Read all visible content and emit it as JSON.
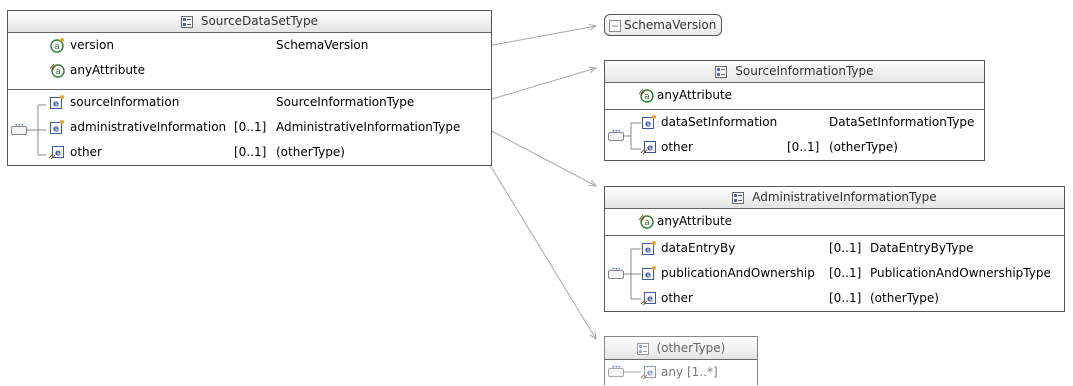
{
  "source_dataset": {
    "title": "SourceDataSetType",
    "attributes": [
      {
        "name": "version",
        "type": "SchemaVersion"
      },
      {
        "name": "anyAttribute",
        "type": ""
      }
    ],
    "elements": [
      {
        "name": "sourceInformation",
        "cardinality": "",
        "type": "SourceInformationType"
      },
      {
        "name": "administrativeInformation",
        "cardinality": "[0..1]",
        "type": "AdministrativeInformationType"
      },
      {
        "name": "other",
        "cardinality": "[0..1]",
        "type": "(otherType)"
      }
    ]
  },
  "schema_version": {
    "title": "SchemaVersion"
  },
  "source_information": {
    "title": "SourceInformationType",
    "attribute": "anyAttribute",
    "elements": [
      {
        "name": "dataSetInformation",
        "cardinality": "",
        "type": "DataSetInformationType"
      },
      {
        "name": "other",
        "cardinality": "[0..1]",
        "type": "(otherType)"
      }
    ]
  },
  "administrative_information": {
    "title": "AdministrativeInformationType",
    "attribute": "anyAttribute",
    "elements": [
      {
        "name": "dataEntryBy",
        "cardinality": "[0..1]",
        "type": "DataEntryByType"
      },
      {
        "name": "publicationAndOwnership",
        "cardinality": "[0..1]",
        "type": "PublicationAndOwnershipType"
      },
      {
        "name": "other",
        "cardinality": "[0..1]",
        "type": "(otherType)"
      }
    ]
  },
  "other_type": {
    "title": "(otherType)",
    "element": "any",
    "cardinality": "[1..*]"
  },
  "colors": {
    "connector": "#a9a9a9",
    "border": "#555555",
    "header_gradient_end": "#e4e4e4"
  },
  "icons": [
    "attribute-icon",
    "any-attribute-icon",
    "element-icon",
    "any-element-icon",
    "sequence-icon",
    "complex-type-icon",
    "simple-type-icon"
  ]
}
